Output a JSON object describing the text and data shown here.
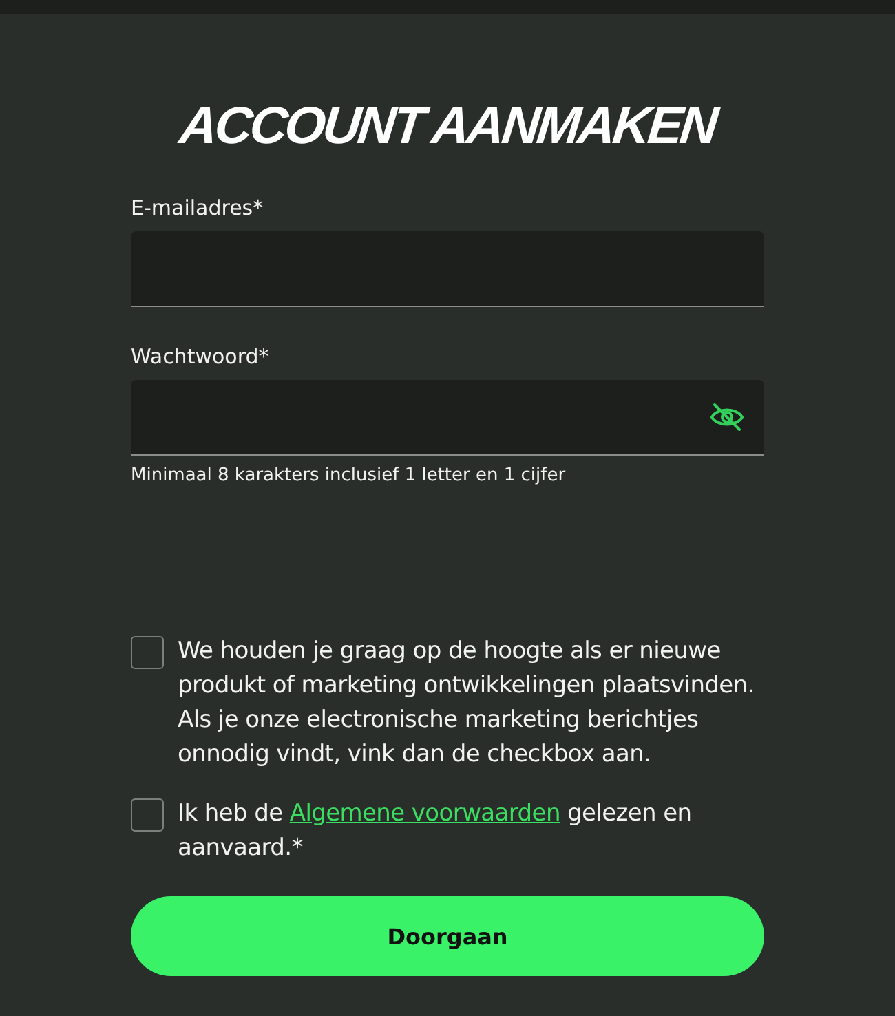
{
  "title": "ACCOUNT AANMAKEN",
  "fields": [
    {
      "label": "E-mailadres*",
      "kind": "email"
    },
    {
      "label": "Wachtwoord*",
      "kind": "password",
      "hint": "Minimaal 8 karakters inclusief 1 letter en 1 cijfer"
    }
  ],
  "checkboxes": [
    {
      "text": "We houden je graag op de hoogte als er nieuwe produkt of marketing ontwikkelingen plaatsvinden. Als je onze electronische marketing berichtjes onnodig vindt, vink dan de checkbox aan.",
      "checked": false
    },
    {
      "text_before": "Ik heb de",
      "link": "Algemene voorwaarden",
      "text_after": "gelezen en aanvaard.*",
      "checked": false
    }
  ],
  "submit_button": "Doorgaan"
}
